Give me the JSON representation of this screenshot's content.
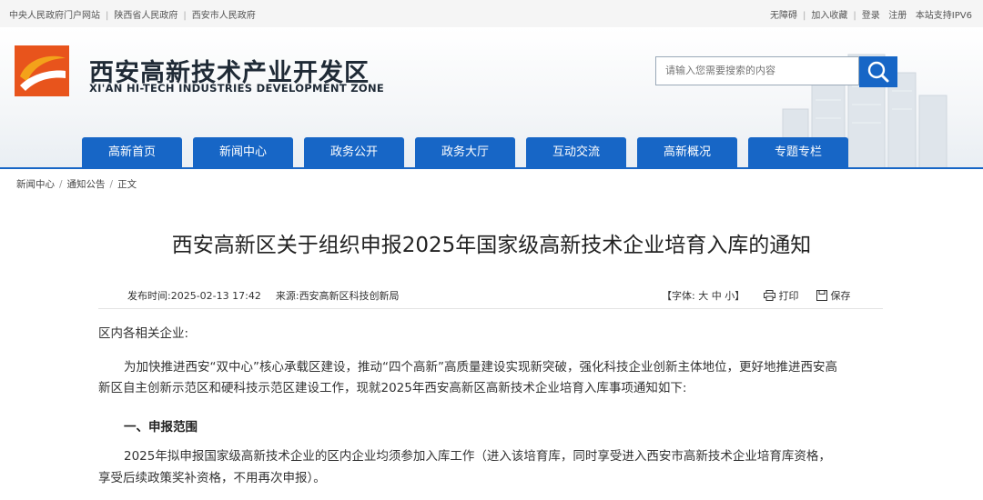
{
  "topbar": {
    "links_left": [
      "中央人民政府门户网站",
      "陕西省人民政府",
      "西安市人民政府"
    ],
    "links_right": [
      "无障碍",
      "加入收藏",
      "登录",
      "注册",
      "本站支持IPV6"
    ]
  },
  "header": {
    "site_name": "西安高新技术产业开发区",
    "site_name_en": "XI'AN HI-TECH INDUSTRIES DEVELOPMENT ZONE",
    "logo_colors": [
      "#e8541c",
      "#f3a21a"
    ],
    "search": {
      "placeholder": "请输入您需要搜索的内容",
      "icon": "search-icon"
    }
  },
  "nav": {
    "items": [
      "高新首页",
      "新闻中心",
      "政务公开",
      "政务大厅",
      "互动交流",
      "高新概况",
      "专题专栏"
    ]
  },
  "breadcrumb": [
    "新闻中心",
    "通知公告",
    "正文"
  ],
  "article": {
    "title": "西安高新区关于组织申报2025年国家级高新技术企业培育入库的通知",
    "publish_label": "发布时间:",
    "publish_time": "2025-02-13 17:42",
    "source_label": "来源:",
    "source": "西安高新区科技创新局",
    "font_label": "【字体:",
    "font_sizes": [
      "大",
      "中",
      "小"
    ],
    "font_close": "】",
    "print_label": "打印",
    "save_label": "保存",
    "salutation": "区内各相关企业:",
    "para1": "为加快推进西安“双中心”核心承载区建设，推动“四个高新”高质量建设实现新突破，强化科技企业创新主体地位，更好地推进西安高",
    "para1b": "新区自主创新示范区和硬科技示范区建设工作，现就2025年西安高新区高新技术企业培育入库事项通知如下:",
    "section1": "一、申报范围",
    "para2": "2025年拟申报国家级高新技术企业的区内企业均须参加入库工作（进入该培育库，同时享受进入西安市高新技术企业培育库资格，",
    "para2b": "享受后续政策奖补资格，不用再次申报）。"
  },
  "colors": {
    "primary": "#1766c6"
  }
}
